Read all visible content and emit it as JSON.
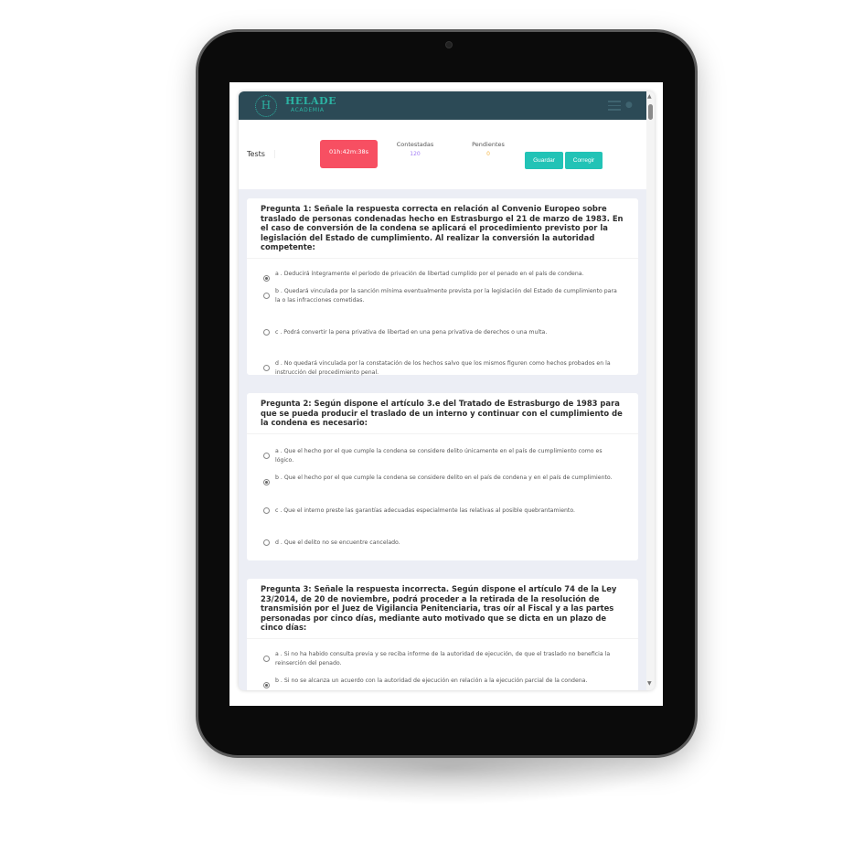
{
  "header": {
    "logo_letter": "H",
    "brand": "HELADE",
    "brand_sub": "ACADEMIA",
    "icons": [
      "menu-icon",
      "user-icon"
    ]
  },
  "toolbar": {
    "section": "Tests",
    "timer": "01h:42m:38s",
    "answered_label": "Contestadas",
    "answered_value": "120",
    "pending_label": "Pendientes",
    "pending_value": "0",
    "save_label": "Guardar",
    "correct_label": "Corregir"
  },
  "colors": {
    "header": "#2c4a56",
    "accent": "#22c3b6",
    "timer": "#f74f62",
    "answered": "#a27cf5",
    "pending": "#f5b544"
  },
  "questions": [
    {
      "text": "Pregunta 1: Señale la respuesta correcta en relación al Convenio Europeo sobre traslado de personas condenadas hecho en Estrasburgo el 21 de marzo de 1983. En el caso de conversión de la condena se aplicará el procedimiento previsto por la legislación del Estado de cumplimiento. Al realizar la conversión la autoridad competente:",
      "selected": 0,
      "options": [
        "a . Deducirá íntegramente el período de privación de libertad cumplido por el penado en el país de condena.",
        "b . Quedará vinculada por la sanción mínima eventualmente prevista por la legislación del Estado de cumplimiento para la o las infracciones cometidas.",
        "c . Podrá convertir la pena privativa de libertad en una pena privativa de derechos o una multa.",
        "d . No quedará vinculada por la constatación de los hechos salvo que los mismos figuren como hechos probados en la instrucción del procedimiento penal."
      ]
    },
    {
      "text": "Pregunta 2: Según dispone el artículo 3.e del Tratado de Estrasburgo de 1983 para que se pueda producir el traslado de un interno y continuar con el cumplimiento de la condena es necesario:",
      "selected": 1,
      "options": [
        "a . Que el hecho por el que cumple la condena se considere delito únicamente en el país de cumplimiento como es lógico.",
        "b . Que el hecho por el que cumple la condena se considere delito en el país de condena y en el país de cumplimiento.",
        "c . Que el interno preste las garantías adecuadas especialmente las relativas al posible quebrantamiento.",
        "d . Que el delito no se encuentre cancelado."
      ]
    },
    {
      "text": "Pregunta 3: Señale la respuesta incorrecta. Según dispone el artículo 74 de la Ley 23/2014, de 20 de noviembre, podrá proceder a la retirada de la resolución de transmisión por el Juez de Vigilancia Penitenciaria, tras oír al Fiscal y a las partes personadas por cinco días, mediante auto motivado que se dicta en un plazo de cinco días:",
      "selected": 1,
      "options": [
        "a . Si no ha habido consulta previa y se reciba informe de la autoridad de ejecución, de que el traslado no beneficia la reinserción del penado.",
        "b . Si no se alcanza un acuerdo con la autoridad de ejecución en relación a la ejecución parcial de la condena."
      ]
    }
  ]
}
